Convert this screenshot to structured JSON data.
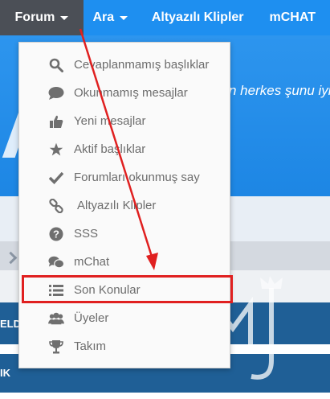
{
  "topnav": {
    "items": [
      {
        "label": "Forum",
        "caret": true,
        "active": true
      },
      {
        "label": "Ara",
        "caret": true
      },
      {
        "label": "Altyazılı Klipler"
      },
      {
        "label": "mCHAT"
      }
    ]
  },
  "banner": {
    "tagline_fragment": "n herkes şunu iyi"
  },
  "background_bars": {
    "bar1_fragment": "ELD",
    "bar2_fragment": "IK"
  },
  "dropdown": {
    "items": [
      {
        "label": "Cevaplanmamış başlıklar",
        "icon": "search-icon"
      },
      {
        "label": "Okunmamış mesajlar",
        "icon": "speech-bubble-icon"
      },
      {
        "label": "Yeni mesajlar",
        "icon": "thumbs-up-icon"
      },
      {
        "label": "Aktif başlıklar",
        "icon": "star-icon"
      },
      {
        "label": "Forumları okunmuş say",
        "icon": "checkmark-icon"
      },
      {
        "label": "Altyazılı Klipler",
        "icon": "link-icon"
      },
      {
        "label": "SSS",
        "icon": "question-circle-icon"
      },
      {
        "label": "mChat",
        "icon": "chat-bubbles-icon"
      },
      {
        "label": "Son Konular",
        "icon": "list-icon",
        "highlighted": true
      },
      {
        "label": "Üyeler",
        "icon": "users-icon"
      },
      {
        "label": "Takım",
        "icon": "trophy-icon"
      }
    ]
  },
  "colors": {
    "nav_bg": "#1e8ff0",
    "nav_active_bg": "#4b4f56",
    "menu_text": "#6d6d6d",
    "menu_icon": "#6f6f6f",
    "annotation_red": "#e02020"
  }
}
